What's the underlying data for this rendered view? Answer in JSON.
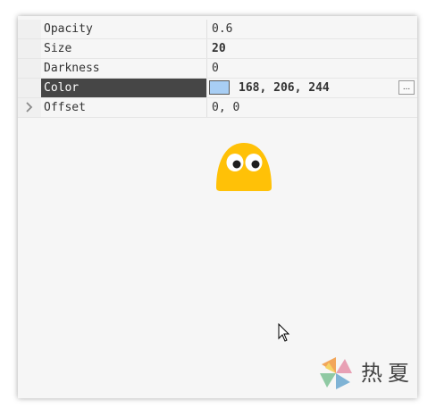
{
  "properties": [
    {
      "name": "Opacity",
      "value": "0.6"
    },
    {
      "name": "Size",
      "value": "20"
    },
    {
      "name": "Darkness",
      "value": "0"
    },
    {
      "name": "Color",
      "value": "168, 206, 244"
    },
    {
      "name": "Offset",
      "value": "0, 0"
    }
  ],
  "color_swatch": "#a8cef4",
  "ellipsis_label": "...",
  "logo_text": "热夏",
  "colors": {
    "selected_bg": "#464646",
    "blob": "#ffc107"
  }
}
